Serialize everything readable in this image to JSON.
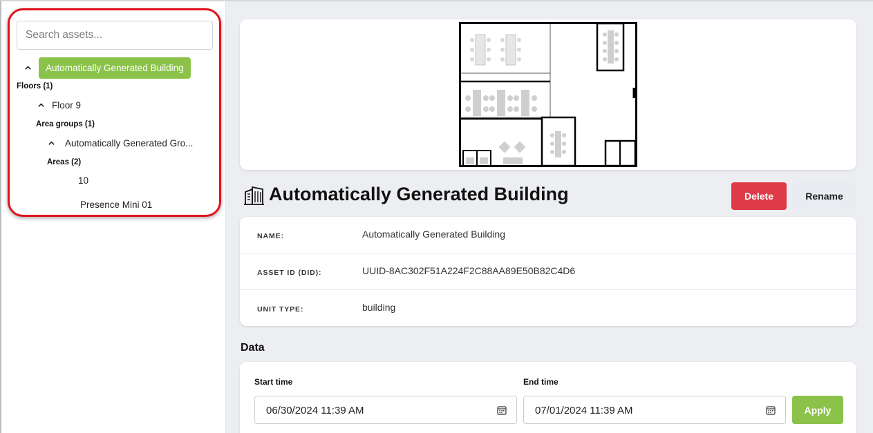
{
  "sidebar": {
    "search_placeholder": "Search assets...",
    "tree": {
      "building_label": "Automatically Generated Building",
      "floors_heading": "Floors (1)",
      "floor_label": "Floor 9",
      "area_groups_heading": "Area groups (1)",
      "area_group_label": "Automatically Generated Gro...",
      "areas_heading": "Areas (2)",
      "areas": [
        "10",
        "Presence Mini 01"
      ]
    }
  },
  "main": {
    "title": "Automatically Generated Building",
    "title_icon": "building-icon",
    "delete_label": "Delete",
    "rename_label": "Rename",
    "properties": [
      {
        "key": "NAME:",
        "value": "Automatically Generated Building"
      },
      {
        "key": "ASSET ID (DID):",
        "value": "UUID-8AC302F51A224F2C88AA89E50B82C4D6"
      },
      {
        "key": "UNIT TYPE:",
        "value": "building"
      }
    ],
    "data_section": {
      "title": "Data",
      "start_label": "Start time",
      "start_value": "06/30/2024 11:39 AM",
      "end_label": "End time",
      "end_value": "07/01/2024 11:39 AM",
      "apply_label": "Apply"
    }
  },
  "colors": {
    "accent_green": "#8bc34a",
    "delete_red": "#dc3b47",
    "highlight_ring": "#e0121a"
  }
}
